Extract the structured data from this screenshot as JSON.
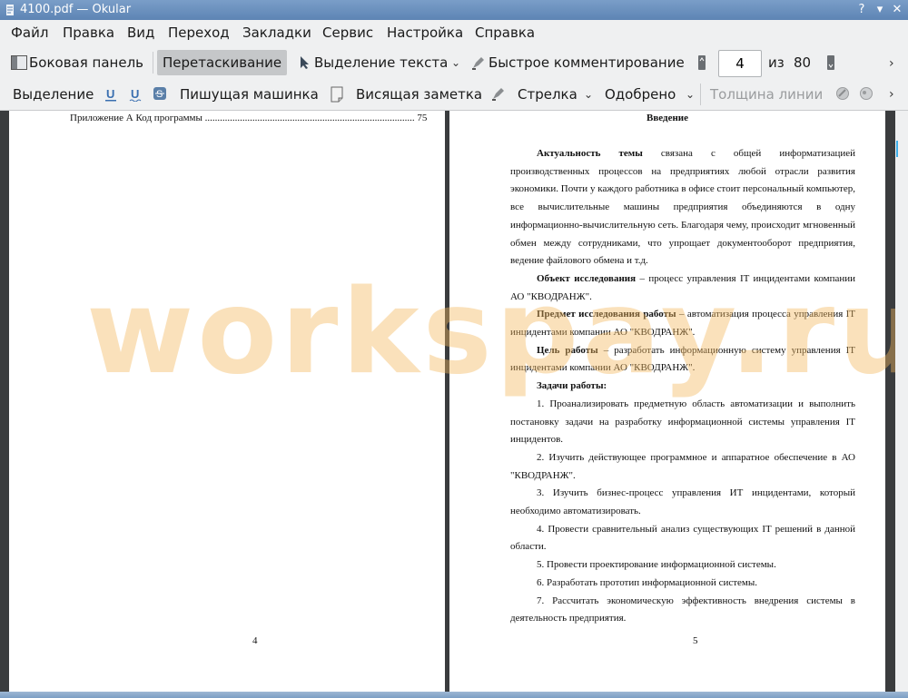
{
  "window": {
    "title": "4100.pdf  — Okular"
  },
  "menu": [
    "Файл",
    "Правка",
    "Вид",
    "Переход",
    "Закладки",
    "Сервис",
    "Настройка",
    "Справка"
  ],
  "toolbar1": {
    "sidebar": "Боковая панель",
    "drag": "Перетаскивание",
    "text_select": "Выделение текста",
    "quick_comment": "Быстрое комментирование",
    "page_current": "4",
    "page_of": "из",
    "page_total": "80"
  },
  "toolbar2": {
    "selection": "Выделение",
    "typewriter": "Пишущая машинка",
    "sticky_note": "Висящая заметка",
    "arrow": "Стрелка",
    "approved": "Одобрено",
    "line_width": "Толщина линии"
  },
  "page_left": {
    "toc_line": "Приложение А Код программы .................................................................................... 75",
    "number": "4"
  },
  "page_right": {
    "heading": "Введение",
    "p1_bold": "Актуальность темы",
    "p1_text": " связана с общей информатизацией производственных процессов на предприятиях любой отрасли развития экономики. Почти у каждого работника в офисе стоит персональный компьютер, все вычислительные машины предприятия объединяются в одну информационно-вычислительную сеть. Благодаря чему, происходит мгновенный обмен между сотрудниками, что упрощает документооборот предприятия, ведение файлового обмена и т.д.",
    "p2_bold": "Объект исследования",
    "p2_text": " – процесс управления IT инцидентами компании АО \"КВОДРАНЖ\".",
    "p3_bold": "Предмет исследования работы",
    "p3_text": " – автоматизация процесса управления IT инцидентами компании АО \"КВОДРАНЖ\".",
    "p4_bold": "Цель работы",
    "p4_text": " – разработать информационную систему управления IT инцидентами компании АО \"КВОДРАНЖ\".",
    "tasks_title": "Задачи работы:",
    "tasks": [
      "1. Проанализировать предметную область автоматизации и выполнить постановку задачи на разработку информационной системы управления IT инцидентов.",
      "2. Изучить действующее программное и аппаратное обеспечение в АО \"КВОДРАНЖ\".",
      "3. Изучить бизнес-процесс управления ИТ инцидентами, который необходимо автоматизировать.",
      "4. Провести сравнительный анализ существующих IT решений в данной области.",
      "5. Провести проектирование информационной системы.",
      "6. Разработать прототип информационной системы.",
      "7. Рассчитать экономическую эффективность внедрения системы в деятельность предприятия."
    ],
    "number": "5"
  },
  "watermark": "workspay.ru",
  "colors": {
    "titlebar": "#6b8fbd",
    "toolbar": "#eff0f1",
    "accent": "#3daee9"
  }
}
